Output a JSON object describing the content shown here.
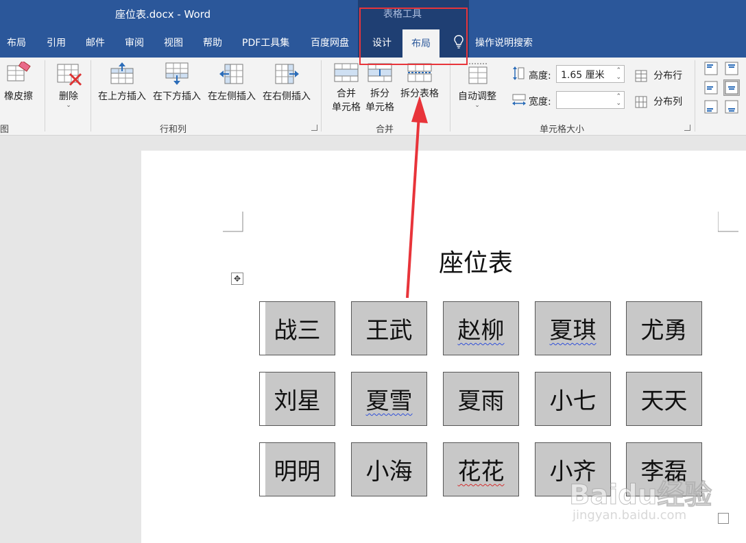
{
  "window": {
    "title": "座位表.docx  -  Word",
    "context_group": "表格工具"
  },
  "tabs": {
    "items": [
      "布局",
      "引用",
      "邮件",
      "审阅",
      "视图",
      "帮助",
      "PDF工具集",
      "百度网盘",
      "设计"
    ],
    "active": "布局",
    "tell_me": "操作说明搜索"
  },
  "ribbon": {
    "draw": {
      "eraser": "橡皮擦",
      "group": "图"
    },
    "rows_cols": {
      "delete": "删除",
      "insert_above": "在上方插入",
      "insert_below": "在下方插入",
      "insert_left": "在左侧插入",
      "insert_right": "在右侧插入",
      "group": "行和列"
    },
    "merge": {
      "merge_cells_1": "合并",
      "merge_cells_2": "单元格",
      "split_cells_1": "拆分",
      "split_cells_2": "单元格",
      "split_table": "拆分表格",
      "group": "合并"
    },
    "cell_size": {
      "autofit": "自动调整",
      "height_label": "高度:",
      "height_value": "1.65 厘米",
      "width_label": "宽度:",
      "width_value": "",
      "distribute_rows": "分布行",
      "distribute_cols": "分布列",
      "group": "单元格大小"
    }
  },
  "document": {
    "title": "座位表",
    "seats": [
      [
        "战三",
        "王武",
        "赵柳",
        "夏琪",
        "尤勇"
      ],
      [
        "刘星",
        "夏雪",
        "夏雨",
        "小七",
        "天天"
      ],
      [
        "明明",
        "小海",
        "花花",
        "小齐",
        "李磊"
      ]
    ]
  },
  "watermark": {
    "main": "Baidu经验",
    "sub": "jingyan.baidu.com"
  },
  "colors": {
    "title_bar": "#2b579a",
    "context_tab": "#1f3f73",
    "highlight": "#e8343a",
    "cell_fill": "#c8c8c8"
  }
}
